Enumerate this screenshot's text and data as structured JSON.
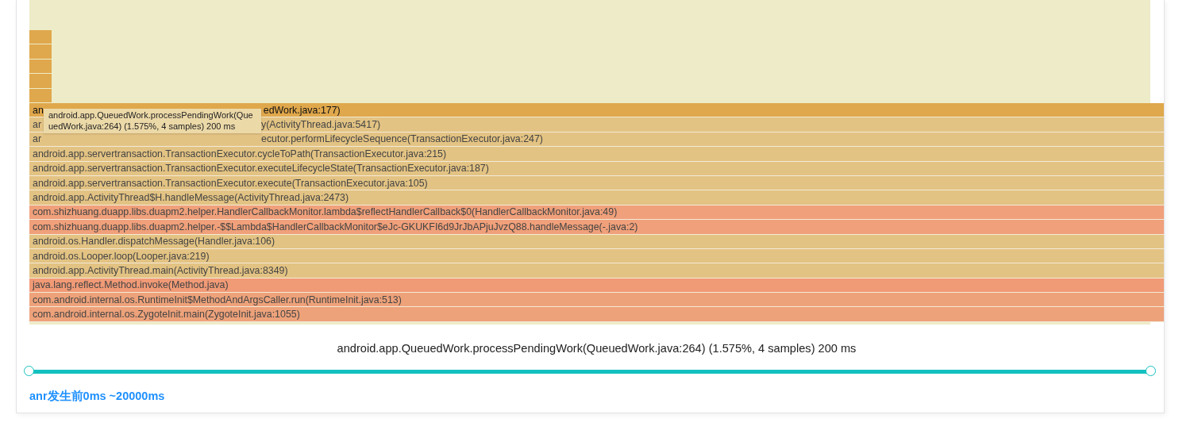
{
  "flame_graph": {
    "upper_frames": [
      {
        "color": "#e0a84c"
      },
      {
        "color": "#e0a84c"
      },
      {
        "color": "#e0a84c"
      },
      {
        "color": "#e0a84c"
      },
      {
        "color": "#e0a84c"
      }
    ],
    "frames": [
      {
        "head": "an",
        "label": "edWork.java:177)",
        "color": "#e0a84c",
        "selected": true
      },
      {
        "head": "ar",
        "label": "y(ActivityThread.java:5417)",
        "color": "#e3c383",
        "selected": false
      },
      {
        "head": "ar",
        "label": "ecutor.performLifecycleSequence(TransactionExecutor.java:247)",
        "color": "#e3c383",
        "selected": false
      },
      {
        "label": "android.app.servertransaction.TransactionExecutor.cycleToPath(TransactionExecutor.java:215)",
        "color": "#e3c383",
        "selected": false
      },
      {
        "label": "android.app.servertransaction.TransactionExecutor.executeLifecycleState(TransactionExecutor.java:187)",
        "color": "#e3c383",
        "selected": false
      },
      {
        "label": "android.app.servertransaction.TransactionExecutor.execute(TransactionExecutor.java:105)",
        "color": "#e3c383",
        "selected": false
      },
      {
        "label": "android.app.ActivityThread$H.handleMessage(ActivityThread.java:2473)",
        "color": "#e3c383",
        "selected": false
      },
      {
        "label": "com.shizhuang.duapp.libs.duapm2.helper.HandlerCallbackMonitor.lambda$reflectHandlerCallback$0(HandlerCallbackMonitor.java:49)",
        "color": "#f0a07a",
        "selected": false
      },
      {
        "label": "com.shizhuang.duapp.libs.duapm2.helper.-$$Lambda$HandlerCallbackMonitor$eJc-GKUKFI6d9JrJbAPjuJvzQ88.handleMessage(-.java:2)",
        "color": "#f0a07a",
        "selected": false
      },
      {
        "label": "android.os.Handler.dispatchMessage(Handler.java:106)",
        "color": "#e3c383",
        "selected": false
      },
      {
        "label": "android.os.Looper.loop(Looper.java:219)",
        "color": "#e3c383",
        "selected": false
      },
      {
        "label": "android.app.ActivityThread.main(ActivityThread.java:8349)",
        "color": "#e3c383",
        "selected": false
      },
      {
        "label": "java.lang.reflect.Method.invoke(Method.java)",
        "color": "#f19a76",
        "selected": false
      },
      {
        "label": "com.android.internal.os.RuntimeInit$MethodAndArgsCaller.run(RuntimeInit.java:513)",
        "color": "#eea27a",
        "selected": false
      },
      {
        "label": "com.android.internal.os.ZygoteInit.main(ZygoteInit.java:1055)",
        "color": "#eea27a",
        "selected": false
      }
    ],
    "tooltip": "android.app.QueuedWork.processPendingWork(QueuedWork.java:264) (1.575%, 4 samples) 200 ms"
  },
  "details": "android.app.QueuedWork.processPendingWork(QueuedWork.java:264) (1.575%, 4 samples) 200 ms",
  "time_range": {
    "handles": [
      {
        "level": 0
      },
      {
        "level": 1
      }
    ],
    "label": "anr发生前0ms ~20000ms"
  }
}
